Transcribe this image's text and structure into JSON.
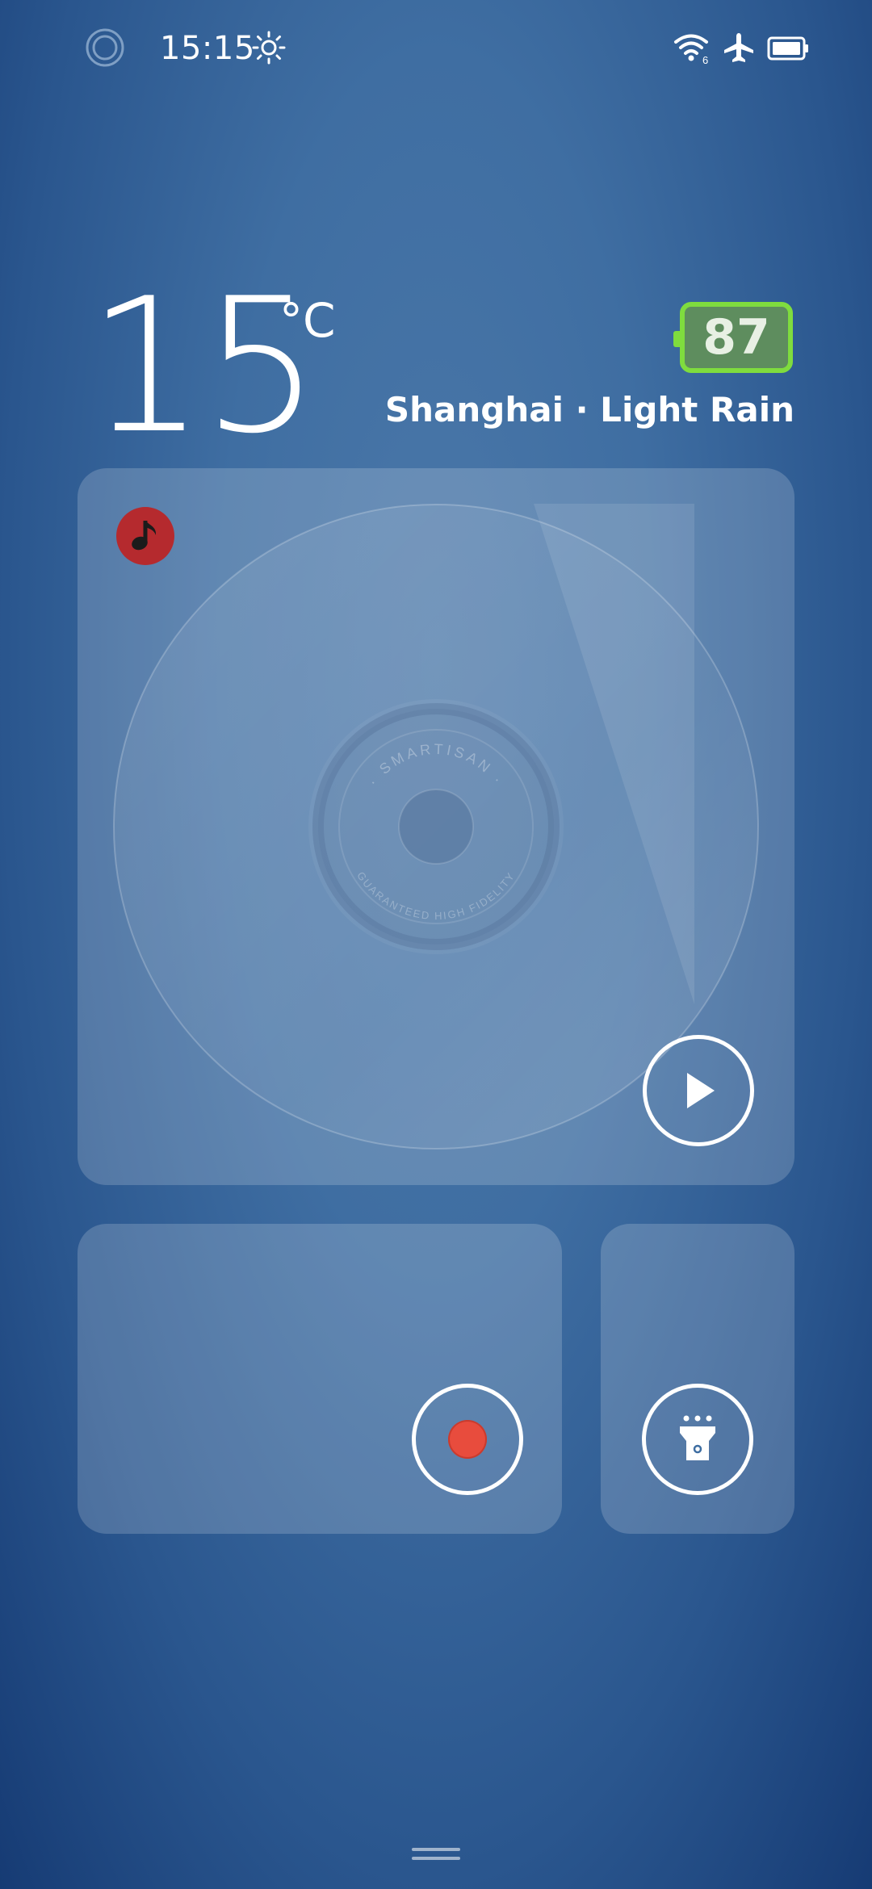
{
  "status_bar": {
    "time": "15:15",
    "icons": [
      "ring-icon",
      "sun-icon",
      "wifi-6-icon",
      "airplane-icon",
      "battery-icon"
    ],
    "wifi_badge": "6"
  },
  "weather": {
    "temperature": "15",
    "unit": "°C",
    "aqi": "87",
    "aqi_color": "#7fdc3e",
    "location": "Shanghai · Light Rain"
  },
  "music_widget": {
    "disc_text_top": "· SMARTISAN ·",
    "disc_text_bottom": "GUARANTEED HIGH FIDELITY",
    "app_icon": "music-note-icon",
    "app_icon_color": "#b52a2e",
    "play_icon": "play-icon"
  },
  "recorder_widget": {
    "record_icon": "record-icon",
    "record_color": "#e84c3d"
  },
  "flashlight_widget": {
    "icon": "flashlight-icon"
  },
  "colors": {
    "background_top": "#3f6ea2",
    "background_bottom": "#163b74"
  }
}
